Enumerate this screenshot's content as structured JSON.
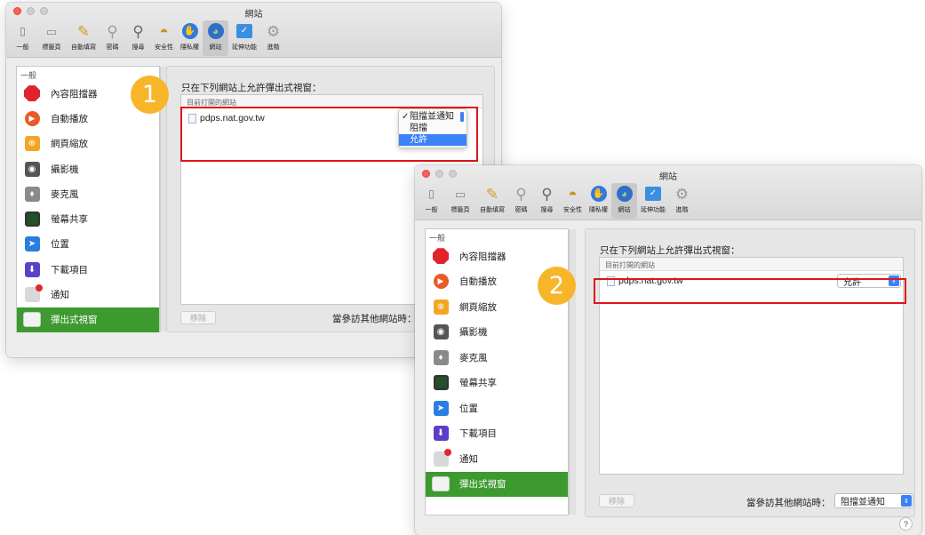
{
  "window": {
    "title": "網站",
    "toolbar": [
      {
        "label": "一般",
        "icon": "general-icon"
      },
      {
        "label": "標籤頁",
        "icon": "tabs-icon"
      },
      {
        "label": "自動填寫",
        "icon": "autofill-icon"
      },
      {
        "label": "密碼",
        "icon": "key-icon"
      },
      {
        "label": "搜尋",
        "icon": "search-icon"
      },
      {
        "label": "安全性",
        "icon": "security-icon"
      },
      {
        "label": "隱私權",
        "icon": "privacy-hand-icon"
      },
      {
        "label": "網站",
        "icon": "globe-icon"
      },
      {
        "label": "延伸功能",
        "icon": "extensions-icon"
      },
      {
        "label": "進階",
        "icon": "gear-icon"
      }
    ]
  },
  "sidebar": {
    "header": "一般",
    "items": [
      {
        "label": "內容阻擋器",
        "icon": "stop-sign-icon"
      },
      {
        "label": "自動播放",
        "icon": "play-icon"
      },
      {
        "label": "網頁縮放",
        "icon": "zoom-icon"
      },
      {
        "label": "攝影機",
        "icon": "camera-icon"
      },
      {
        "label": "麥克風",
        "icon": "microphone-icon"
      },
      {
        "label": "螢幕共享",
        "icon": "screen-share-icon"
      },
      {
        "label": "位置",
        "icon": "location-arrow-icon"
      },
      {
        "label": "下載項目",
        "icon": "download-icon"
      },
      {
        "label": "通知",
        "icon": "notification-icon"
      },
      {
        "label": "彈出式視窗",
        "icon": "popup-window-icon"
      }
    ]
  },
  "main": {
    "heading": "只在下列網站上允許彈出式視窗：",
    "list_header": "目前打開的網站",
    "site": "pdps.nat.gov.tw",
    "remove_button": "移除",
    "other_sites_label": "當參訪其他網站時：",
    "other_sites_value": "阻擋並通知"
  },
  "step1": {
    "badge": "1",
    "menu": {
      "options": [
        "阻擋並通知",
        "阻擋",
        "允許"
      ],
      "checked": "阻擋並通知",
      "highlighted": "允許"
    }
  },
  "step2": {
    "badge": "2",
    "site_value": "允許"
  },
  "help": "?",
  "colors": {
    "accent": "#3b82f6",
    "sidebar_selected": "#3c9a2f",
    "highlight_box": "#e0151b",
    "badge": "#f7b62a"
  }
}
